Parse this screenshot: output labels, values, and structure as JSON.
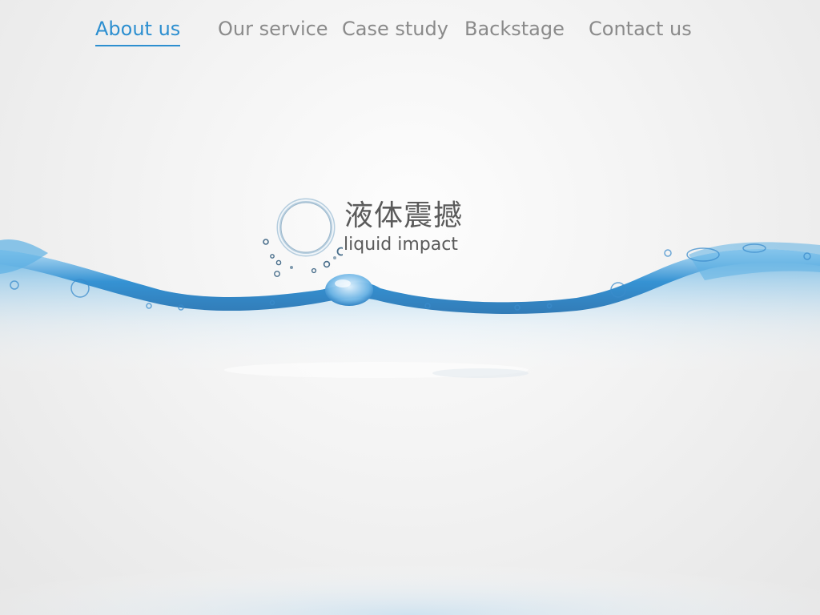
{
  "nav": {
    "items": [
      {
        "label": "About us",
        "active": true
      },
      {
        "label": "Our service",
        "active": false
      },
      {
        "label": "Case study",
        "active": false
      },
      {
        "label": "Backstage",
        "active": false
      },
      {
        "label": "Contact us",
        "active": false
      }
    ]
  },
  "logo": {
    "title": "液体震撼",
    "subtitle": "liquid impact",
    "icon": "water-ring-icon"
  },
  "colors": {
    "accent": "#2d8fd0",
    "nav_text": "#8a8a8a",
    "logo_text": "#5a5a5a",
    "water": "#3a9ad9",
    "background": "#f2f2f2"
  }
}
